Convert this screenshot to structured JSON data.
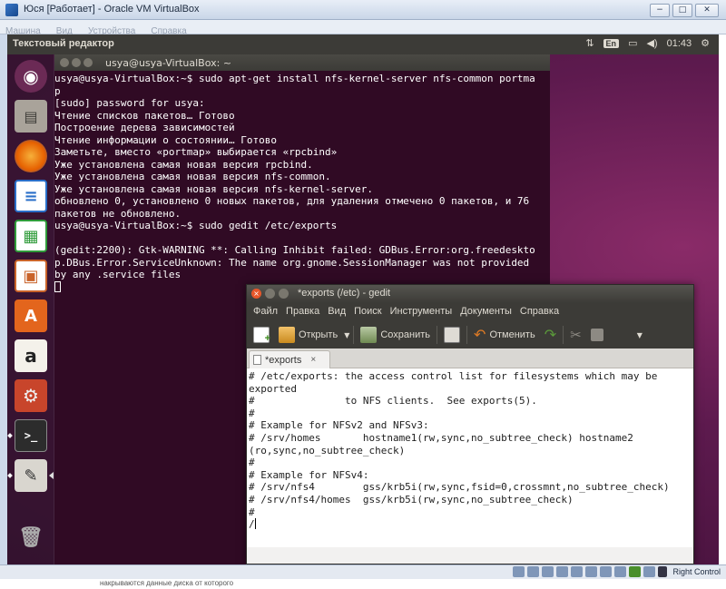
{
  "host_window": {
    "title": "Юся [Работает] - Oracle VM VirtualBox",
    "buttons": [
      "−",
      "□",
      "✕"
    ],
    "menu": [
      "Машина",
      "Вид",
      "Устройства",
      "Справка"
    ],
    "statusbar": {
      "host_key_label": "Right Control"
    },
    "below_text": "накрываются данные диска от которого"
  },
  "ubuntu_panel": {
    "title": "Текстовый редактор",
    "keyboard_layout": "En",
    "time": "01:43"
  },
  "launcher": {
    "items": [
      {
        "name": "ubuntu-dash",
        "glyph": "◉",
        "color": "#e95420"
      },
      {
        "name": "files",
        "glyph": "🗄",
        "color": "#a9a39a"
      },
      {
        "name": "firefox",
        "glyph": "●",
        "color": "#e66000"
      },
      {
        "name": "libreoffice-writer",
        "glyph": "≡",
        "color": "#2a6fc9"
      },
      {
        "name": "libreoffice-calc",
        "glyph": "▦",
        "color": "#2f9b3a"
      },
      {
        "name": "libreoffice-impress",
        "glyph": "▣",
        "color": "#c9632a"
      },
      {
        "name": "software-center",
        "glyph": "A",
        "color": "#e3651d"
      },
      {
        "name": "amazon",
        "glyph": "a",
        "color": "#f4f1ea"
      },
      {
        "name": "system-settings",
        "glyph": "⚙",
        "color": "#c8452b"
      },
      {
        "name": "terminal",
        "glyph": ">_",
        "color": "#2c2c2c"
      },
      {
        "name": "text-editor",
        "glyph": "✎",
        "color": "#d9d6cf"
      },
      {
        "name": "trash",
        "glyph": "🗑",
        "color": "#6f6a62"
      }
    ]
  },
  "terminal": {
    "title": "usya@usya-VirtualBox: ~",
    "lines": [
      "usya@usya-VirtualBox:~$ sudo apt-get install nfs-kernel-server nfs-common portma",
      "p",
      "[sudo] password for usya:",
      "Чтение списков пакетов… Готово",
      "Построение дерева зависимостей",
      "Чтение информации о состоянии… Готово",
      "Заметьте, вместо «portmap» выбирается «rpcbind»",
      "Уже установлена самая новая версия rpcbind.",
      "Уже установлена самая новая версия nfs-common.",
      "Уже установлена самая новая версия nfs-kernel-server.",
      "обновлено 0, установлено 0 новых пакетов, для удаления отмечено 0 пакетов, и 76",
      "пакетов не обновлено.",
      "usya@usya-VirtualBox:~$ sudo gedit /etc/exports",
      "",
      "(gedit:2200): Gtk-WARNING **: Calling Inhibit failed: GDBus.Error:org.freedeskto",
      "p.DBus.Error.ServiceUnknown: The name org.gnome.SessionManager was not provided",
      "by any .service files"
    ]
  },
  "gedit": {
    "title": "*exports (/etc) - gedit",
    "menu": [
      "Файл",
      "Правка",
      "Вид",
      "Поиск",
      "Инструменты",
      "Документы",
      "Справка"
    ],
    "toolbar": {
      "open_label": "Открыть",
      "save_label": "Сохранить",
      "undo_label": "Отменить"
    },
    "tab_label": "*exports",
    "tab_close": "×",
    "content": [
      "# /etc/exports: the access control list for filesystems which may be",
      "exported",
      "#               to NFS clients.  See exports(5).",
      "#",
      "# Example for NFSv2 and NFSv3:",
      "# /srv/homes       hostname1(rw,sync,no_subtree_check) hostname2",
      "(ro,sync,no_subtree_check)",
      "#",
      "# Example for NFSv4:",
      "# /srv/nfs4        gss/krb5i(rw,sync,fsid=0,crossmnt,no_subtree_check)",
      "# /srv/nfs4/homes  gss/krb5i(rw,sync,no_subtree_check)",
      "#",
      "/"
    ]
  }
}
